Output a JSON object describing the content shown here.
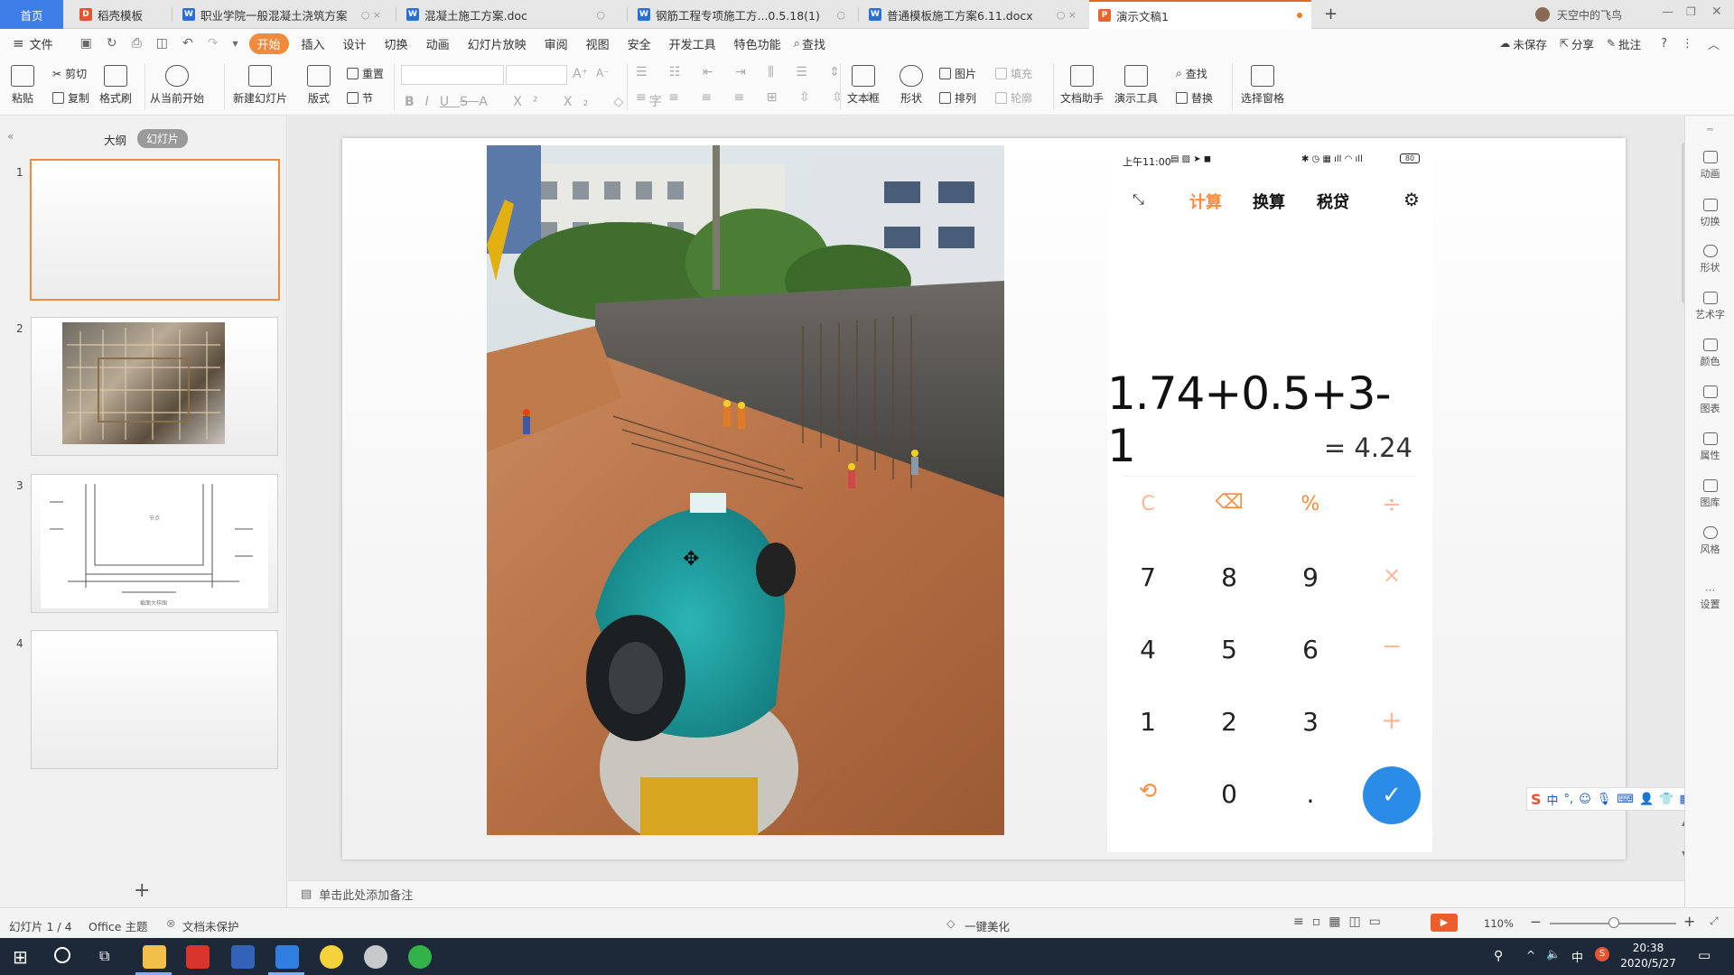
{
  "tabs": [
    {
      "label": "首页"
    },
    {
      "label": "稻壳模板"
    },
    {
      "label": "职业学院一般混凝土浇筑方案"
    },
    {
      "label": "混凝土施工方案.doc"
    },
    {
      "label": "钢筋工程专项施工方...0.5.18(1)"
    },
    {
      "label": "普通模板施工方案6.11.docx"
    },
    {
      "label": "演示文稿1"
    }
  ],
  "user_name": "天空中的飞鸟",
  "menu": {
    "file": "文件",
    "items": [
      "开始",
      "插入",
      "设计",
      "切换",
      "动画",
      "幻灯片放映",
      "审阅",
      "视图",
      "安全",
      "开发工具",
      "特色功能"
    ],
    "search": "查找",
    "unsaved": "未保存",
    "share": "分享",
    "comment": "批注"
  },
  "ribbon": {
    "paste": "粘贴",
    "cut": "剪切",
    "copy": "复制",
    "format_painter": "格式刷",
    "play_from_current": "从当前开始",
    "new_slide": "新建幻灯片",
    "layout": "版式",
    "reset": "重置",
    "section": "节",
    "textbox": "文本框",
    "shape": "形状",
    "picture": "图片",
    "fill": "填充",
    "arrange": "排列",
    "outline": "轮廓",
    "doc_helper": "文档助手",
    "presentation_tools": "演示工具",
    "find": "查找",
    "replace": "替换",
    "select_pane": "选择窗格"
  },
  "left_panel": {
    "outline_tab": "大纲",
    "slides_tab": "幻灯片",
    "slide_numbers": [
      "1",
      "2",
      "3",
      "4"
    ],
    "add": "+"
  },
  "calculator": {
    "status_time": "上午11:00",
    "battery": "80",
    "tabs": [
      "计算",
      "换算",
      "税贷"
    ],
    "expression": "1.74+0.5+3-1",
    "result": "= 4.24",
    "keys": {
      "clear": "C",
      "percent": "%",
      "divide": "÷",
      "multiply": "×",
      "minus": "−",
      "plus": "+",
      "k7": "7",
      "k8": "8",
      "k9": "9",
      "k4": "4",
      "k5": "5",
      "k6": "6",
      "k1": "1",
      "k2": "2",
      "k3": "3",
      "k0": "0",
      "dot": "."
    }
  },
  "notes_placeholder": "单击此处添加备注",
  "right_tools": [
    "动画",
    "切换",
    "形状",
    "艺术字",
    "颜色",
    "图表",
    "属性",
    "图库",
    "风格",
    "设置"
  ],
  "status": {
    "slide_info": "幻灯片 1 / 4",
    "theme": "Office 主题",
    "protect": "文档未保护",
    "beautify": "一键美化",
    "zoom": "110%"
  },
  "taskbar": {
    "time": "20:38",
    "date": "2020/5/27",
    "ime": "中"
  },
  "colors": {
    "accent": "#f08a3c",
    "calc_orange": "#ff8a3d",
    "calc_blue": "#2a8ce6",
    "taskbar": "#1d2938"
  }
}
